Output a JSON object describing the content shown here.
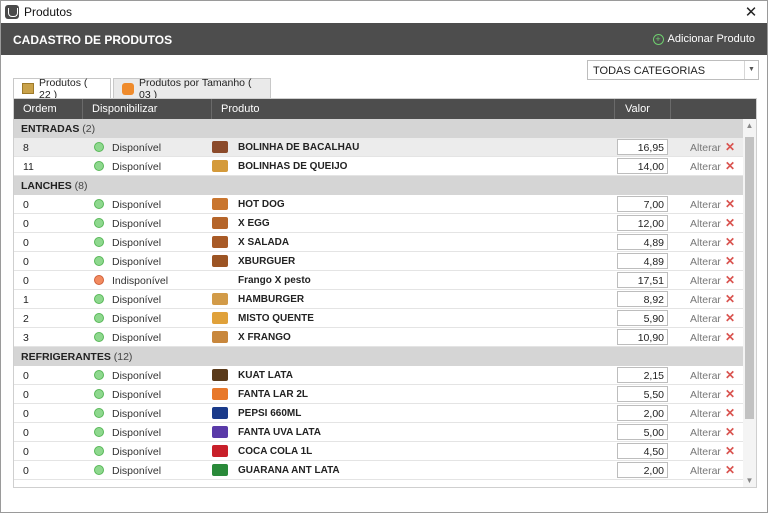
{
  "window": {
    "title": "Produtos"
  },
  "header": {
    "title": "CADASTRO DE PRODUTOS",
    "add_label": "Adicionar Produto"
  },
  "filter": {
    "selected": "TODAS CATEGORIAS"
  },
  "tabs": [
    {
      "label": "Produtos ( 22 )"
    },
    {
      "label": "Produtos por Tamanho ( 03 )"
    }
  ],
  "columns": {
    "ordem": "Ordem",
    "disponibilizar": "Disponibilizar",
    "produto": "Produto",
    "valor": "Valor"
  },
  "row_action": {
    "edit": "Alterar",
    "delete": "✕"
  },
  "groups": [
    {
      "name": "ENTRADAS",
      "count": "(2)",
      "items": [
        {
          "ordem": "8",
          "status": "Disponível",
          "available": true,
          "name": "BOLINHA DE BACALHAU",
          "valor": "16,95",
          "icon": "bacalhau-icon",
          "color": "#8b4a2a"
        },
        {
          "ordem": "11",
          "status": "Disponível",
          "available": true,
          "name": "BOLINHAS DE QUEIJO",
          "valor": "14,00",
          "icon": "queijo-icon",
          "color": "#d49a3a"
        }
      ]
    },
    {
      "name": "LANCHES",
      "count": "(8)",
      "items": [
        {
          "ordem": "0",
          "status": "Disponível",
          "available": true,
          "name": "HOT DOG",
          "valor": "7,00",
          "icon": "hotdog-icon",
          "color": "#c9752e"
        },
        {
          "ordem": "0",
          "status": "Disponível",
          "available": true,
          "name": "X EGG",
          "valor": "12,00",
          "icon": "burger-icon",
          "color": "#b5652a"
        },
        {
          "ordem": "0",
          "status": "Disponível",
          "available": true,
          "name": "X SALADA",
          "valor": "4,89",
          "icon": "burger-icon",
          "color": "#a85a26"
        },
        {
          "ordem": "0",
          "status": "Disponível",
          "available": true,
          "name": "XBURGUER",
          "valor": "4,89",
          "icon": "burger-icon",
          "color": "#9c5424"
        },
        {
          "ordem": "0",
          "status": "Indisponível",
          "available": false,
          "name": "Frango X pesto",
          "valor": "17,51",
          "icon": "",
          "color": ""
        },
        {
          "ordem": "1",
          "status": "Disponível",
          "available": true,
          "name": "HAMBURGER",
          "valor": "8,92",
          "icon": "burger-icon",
          "color": "#d29b48"
        },
        {
          "ordem": "2",
          "status": "Disponível",
          "available": true,
          "name": "MISTO QUENTE",
          "valor": "5,90",
          "icon": "sandwich-icon",
          "color": "#e0a13a"
        },
        {
          "ordem": "3",
          "status": "Disponível",
          "available": true,
          "name": "X FRANGO",
          "valor": "10,90",
          "icon": "burger-icon",
          "color": "#c8873c"
        }
      ]
    },
    {
      "name": "REFRIGERANTES",
      "count": "(12)",
      "items": [
        {
          "ordem": "0",
          "status": "Disponível",
          "available": true,
          "name": "KUAT LATA",
          "valor": "2,15",
          "icon": "can-icon",
          "color": "#5a3a1a"
        },
        {
          "ordem": "0",
          "status": "Disponível",
          "available": true,
          "name": "FANTA LAR 2L",
          "valor": "5,50",
          "icon": "bottle-icon",
          "color": "#e8782a"
        },
        {
          "ordem": "0",
          "status": "Disponível",
          "available": true,
          "name": "PEPSI 660ML",
          "valor": "2,00",
          "icon": "bottle-icon",
          "color": "#1a3a8a"
        },
        {
          "ordem": "0",
          "status": "Disponível",
          "available": true,
          "name": "FANTA UVA LATA",
          "valor": "5,00",
          "icon": "can-icon",
          "color": "#5a3aa8"
        },
        {
          "ordem": "0",
          "status": "Disponível",
          "available": true,
          "name": "COCA  COLA 1L",
          "valor": "4,50",
          "icon": "bottle-icon",
          "color": "#c8202a"
        },
        {
          "ordem": "0",
          "status": "Disponível",
          "available": true,
          "name": "GUARANA ANT LATA",
          "valor": "2,00",
          "icon": "can-icon",
          "color": "#2a8a3a"
        }
      ]
    }
  ]
}
